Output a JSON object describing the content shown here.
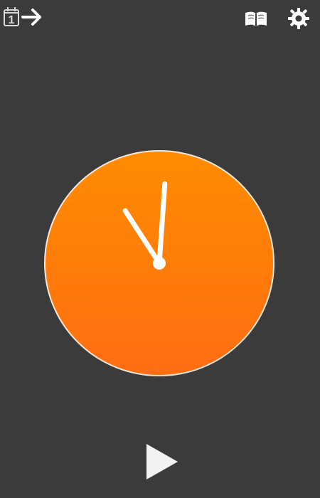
{
  "header": {
    "left": {
      "icon": "calendar-day-arrow-icon",
      "day_number": "1"
    },
    "right": [
      {
        "icon": "book-icon"
      },
      {
        "icon": "gear-icon"
      }
    ]
  },
  "clock": {
    "face_color_top": "#ff8c00",
    "face_color_bottom": "#ff6d12",
    "rim_color": "#ffffff",
    "hands_color": "#ffffff",
    "time": "11:00"
  },
  "controls": {
    "play_icon": "play-icon",
    "play_color": "#f2f2f2"
  }
}
